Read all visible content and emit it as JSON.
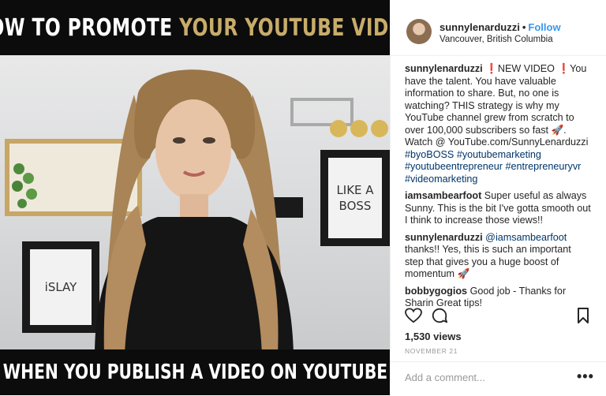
{
  "video": {
    "title_white": "HOW TO PROMOTE",
    "title_gold": "YOUR YOUTUBE VIDEO",
    "caption": "WHEN YOU PUBLISH A VIDEO ON YOUTUBE",
    "frame_islay": "iSLAY",
    "frame_boss": "LIKE A BOSS"
  },
  "header": {
    "username": "sunnylenarduzzi",
    "separator": "•",
    "follow_label": "Follow",
    "location": "Vancouver, British Columbia"
  },
  "caption_post": {
    "user": "sunnylenarduzzi",
    "text_1": "NEW VIDEO",
    "text_2": "You have the talent. You have valuable information to share. But, no one is watching? THIS strategy is why my YouTube channel grew from scratch to over 100,000 subscribers so fast 🚀. Watch @ YouTube.com/SunnyLenarduzzi",
    "tags": [
      "#byoBOSS",
      "#youtubemarketing",
      "#youtubeentrepreneur",
      "#entrepreneuryvr",
      "#videomarketing"
    ]
  },
  "comments": [
    {
      "user": "iamsambearfoot",
      "text": "Super useful as always Sunny. This is the bit I've gotta smooth out I think to increase those views!!"
    },
    {
      "user": "sunnylenarduzzi",
      "mention": "@iamsambearfoot",
      "text": "thanks!! Yes, this is such an important step that gives you a huge boost of momentum 🚀"
    },
    {
      "user": "bobbygogios",
      "text": "Good job - Thanks for Sharin Great tips!"
    }
  ],
  "stats": {
    "views": "1,530 views",
    "date": "NOVEMBER 21"
  },
  "add_comment": {
    "placeholder": "Add a comment...",
    "more": "•••"
  },
  "icons": {
    "like": "heart-icon",
    "comment": "comment-bubble-icon",
    "save": "bookmark-icon",
    "exclamation": "red-exclamation-icon"
  },
  "colors": {
    "link_blue": "#3897f0",
    "tag_blue": "#003569",
    "title_gold": "#c8ac6a",
    "emoji_red": "#e0201f"
  }
}
